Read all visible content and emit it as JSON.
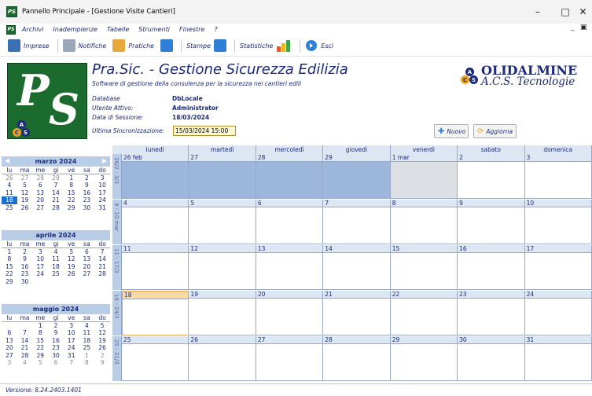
{
  "window": {
    "title": "Pannello Principale - [Gestione Visite Cantieri]",
    "icon_text": "PS"
  },
  "menu": [
    {
      "label": "Archivi"
    },
    {
      "label": "Inadempienze"
    },
    {
      "label": "Tabelle"
    },
    {
      "label": "Strumenti"
    },
    {
      "label": "Finestre"
    },
    {
      "label": "?"
    }
  ],
  "toolbar": [
    {
      "label": "Imprese",
      "icon": "building-icon",
      "color": "#3b6fb5"
    },
    {
      "label": "Notifiche",
      "icon": "document-icon",
      "color": "#9aa7b8"
    },
    {
      "label": "Pratiche",
      "icon": "folder-icon",
      "color": "#e6a93a"
    },
    {
      "label": "Stampe",
      "icon": "printer-icon",
      "color": "#2f7fd8"
    },
    {
      "label": "Statistiche",
      "icon": "bar-chart-icon",
      "color": "#3aa84a"
    },
    {
      "label": "Esci",
      "icon": "exit-icon",
      "color": "#2f7fd8"
    }
  ],
  "header": {
    "logo_p": "P",
    "logo_s": "S",
    "app_title": "Pra.Sic. - Gestione Sicurezza Edilizia",
    "app_subtitle": "Software di gestione della consulenza per la sicurezza nei cantieri edili",
    "database_label": "Database",
    "database_value": "DbLocale",
    "user_label": "Utente Attivo:",
    "user_value": "Administrator",
    "session_label": "Data di Sessione:",
    "session_value": "18/03/2024",
    "sync_label": "Ultima Sincronizzazione:",
    "sync_value": "15/03/2024 15:00",
    "brand_name": "OLIDALMINE",
    "brand_tech": "A.C.S. Tecnologie",
    "acs_a": "A",
    "acs_c": "C",
    "acs_s": "S",
    "new_button": "Nuovo",
    "refresh_button": "Aggiorna"
  },
  "mini_calendars": {
    "day_names": [
      "lu",
      "ma",
      "me",
      "gi",
      "ve",
      "sa",
      "do"
    ],
    "months": [
      {
        "name": "marzo 2024",
        "weeks": [
          [
            "26",
            "27",
            "28",
            "29",
            "1",
            "2",
            "3"
          ],
          [
            "4",
            "5",
            "6",
            "7",
            "8",
            "9",
            "10"
          ],
          [
            "11",
            "12",
            "13",
            "14",
            "15",
            "16",
            "17"
          ],
          [
            "18",
            "19",
            "20",
            "21",
            "22",
            "23",
            "24"
          ],
          [
            "25",
            "26",
            "27",
            "28",
            "29",
            "30",
            "31"
          ]
        ]
      },
      {
        "name": "aprile 2024",
        "weeks": [
          [
            "1",
            "2",
            "3",
            "4",
            "5",
            "6",
            "7"
          ],
          [
            "8",
            "9",
            "10",
            "11",
            "12",
            "13",
            "14"
          ],
          [
            "15",
            "16",
            "17",
            "18",
            "19",
            "20",
            "21"
          ],
          [
            "22",
            "23",
            "24",
            "25",
            "26",
            "27",
            "28"
          ],
          [
            "29",
            "30",
            "",
            "",
            "",
            "",
            ""
          ]
        ]
      },
      {
        "name": "maggio 2024",
        "weeks": [
          [
            "",
            "",
            "1",
            "2",
            "3",
            "4",
            "5"
          ],
          [
            "6",
            "7",
            "8",
            "9",
            "10",
            "11",
            "12"
          ],
          [
            "13",
            "14",
            "15",
            "16",
            "17",
            "18",
            "19"
          ],
          [
            "20",
            "21",
            "22",
            "23",
            "24",
            "25",
            "26"
          ],
          [
            "27",
            "28",
            "29",
            "30",
            "31",
            "1",
            "2"
          ],
          [
            "3",
            "4",
            "5",
            "6",
            "7",
            "8",
            "9"
          ]
        ]
      }
    ]
  },
  "calendar": {
    "weekdays": [
      "lunedì",
      "martedì",
      "mercoledì",
      "giovedì",
      "venerdì",
      "sabato",
      "domenica"
    ],
    "weeks": [
      {
        "label": "26/2 - 3/3",
        "days": [
          "26 feb",
          "27",
          "28",
          "29",
          "1 mar",
          "2",
          "3"
        ]
      },
      {
        "label": "4 - 10 mar",
        "days": [
          "4",
          "5",
          "6",
          "7",
          "8",
          "9",
          "10"
        ]
      },
      {
        "label": "11 - 17/3",
        "days": [
          "11",
          "12",
          "13",
          "14",
          "15",
          "16",
          "17"
        ]
      },
      {
        "label": "18 - 24/3",
        "days": [
          "18",
          "19",
          "20",
          "21",
          "22",
          "23",
          "24"
        ]
      },
      {
        "label": "25 - 31/3",
        "days": [
          "25",
          "26",
          "27",
          "28",
          "29",
          "30",
          "31"
        ]
      }
    ]
  },
  "status": {
    "version": "Versione: 8.24.2403.1401"
  }
}
